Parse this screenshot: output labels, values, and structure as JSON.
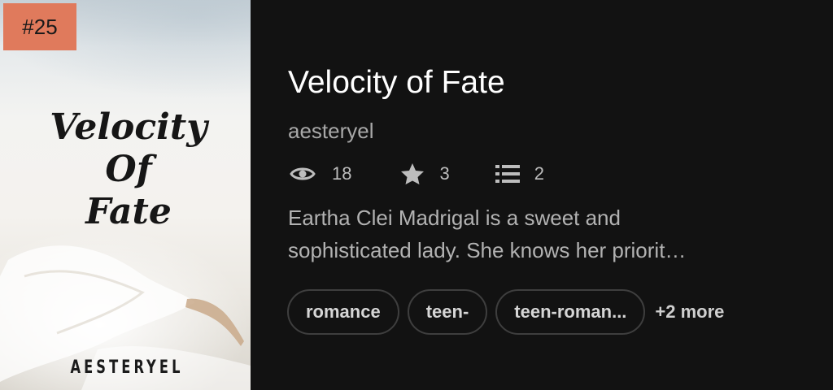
{
  "rank": "#25",
  "cover": {
    "title_lines": [
      "Velocity",
      "Of",
      "Fate"
    ],
    "author": "AESTERYEL"
  },
  "story": {
    "title": "Velocity of Fate",
    "author": "aesteryel",
    "stats": {
      "reads": "18",
      "reads_icon": "eye-icon",
      "votes": "3",
      "votes_icon": "star-icon",
      "parts": "2",
      "parts_icon": "list-icon"
    },
    "description_lines": [
      "Eartha Clei Madrigal is a sweet and",
      "sophisticated lady. She knows her priorit…"
    ],
    "tags": [
      "romance",
      "teen-",
      "teen-roman..."
    ],
    "more_tags": "+2 more"
  },
  "colors": {
    "background": "#121212",
    "badge": "#e07a5c"
  }
}
